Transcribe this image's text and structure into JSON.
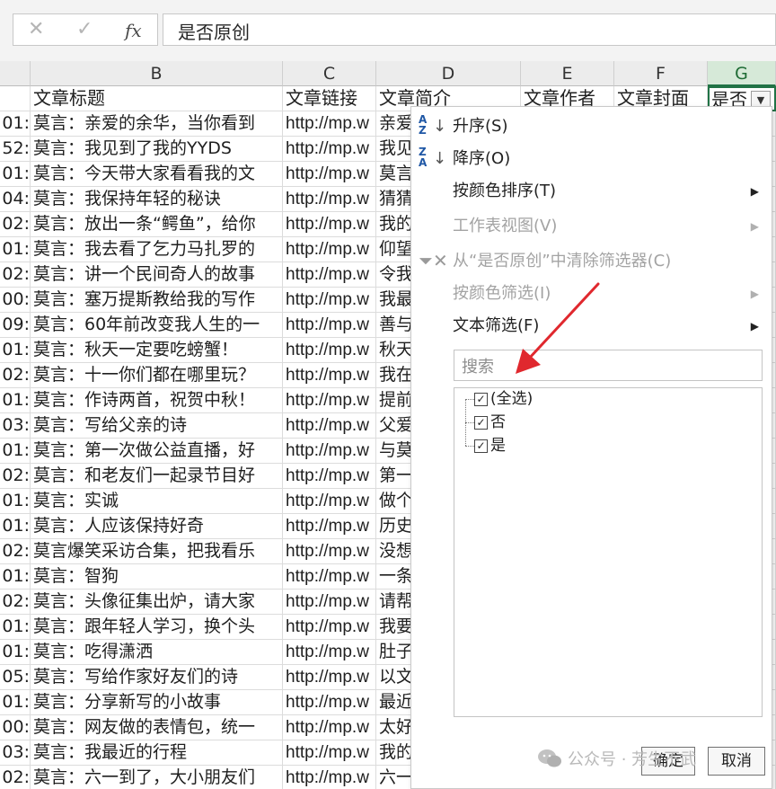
{
  "formula_bar": {
    "cancel_icon": "✕",
    "enter_icon": "✓",
    "fx_label": "fx",
    "value": "是否原创"
  },
  "columns": [
    "B",
    "C",
    "D",
    "E",
    "F",
    "G"
  ],
  "header_row": {
    "a": "",
    "b": "文章标题",
    "c": "文章链接",
    "d": "文章简介",
    "e": "文章作者",
    "f": "文章封面",
    "g": "是否"
  },
  "rows": [
    {
      "a": ":01",
      "b": "莫言：亲爱的余华，当你看到",
      "c": "http://mp.w",
      "d": "亲爱"
    },
    {
      "a": ":52",
      "b": "莫言：我见到了我的YYDS",
      "c": "http://mp.w",
      "d": "我见"
    },
    {
      "a": ":01",
      "b": "莫言：今天带大家看看我的文",
      "c": "http://mp.w",
      "d": "莫言"
    },
    {
      "a": ":04",
      "b": "莫言：我保持年轻的秘诀",
      "c": "http://mp.w",
      "d": "猜猜"
    },
    {
      "a": ":02",
      "b": "莫言：放出一条“鳄鱼”，给你",
      "c": "http://mp.w",
      "d": "我的"
    },
    {
      "a": ":01",
      "b": "莫言：我去看了乞力马扎罗的",
      "c": "http://mp.w",
      "d": "仰望"
    },
    {
      "a": ":02",
      "b": "莫言：讲一个民间奇人的故事",
      "c": "http://mp.w",
      "d": "令我"
    },
    {
      "a": ":00",
      "b": "莫言：塞万提斯教给我的写作",
      "c": "http://mp.w",
      "d": "我最"
    },
    {
      "a": ":09",
      "b": "莫言：60年前改变我人生的一",
      "c": "http://mp.w",
      "d": "善与"
    },
    {
      "a": ":01",
      "b": "莫言：秋天一定要吃螃蟹！",
      "c": "http://mp.w",
      "d": "秋天"
    },
    {
      "a": ":02",
      "b": "莫言：十一你们都在哪里玩？",
      "c": "http://mp.w",
      "d": "我在"
    },
    {
      "a": ":01",
      "b": "莫言：作诗两首，祝贺中秋！",
      "c": "http://mp.w",
      "d": "提前"
    },
    {
      "a": ":03",
      "b": "莫言：写给父亲的诗",
      "c": "http://mp.w",
      "d": "父爱"
    },
    {
      "a": ":01",
      "b": "莫言：第一次做公益直播，好",
      "c": "http://mp.w",
      "d": "与莫"
    },
    {
      "a": ":02",
      "b": "莫言：和老友们一起录节目好",
      "c": "http://mp.w",
      "d": "第一"
    },
    {
      "a": ":01",
      "b": "莫言：实诚",
      "c": "http://mp.w",
      "d": "做个"
    },
    {
      "a": ":01",
      "b": "莫言：人应该保持好奇",
      "c": "http://mp.w",
      "d": "历史"
    },
    {
      "a": ":02",
      "b": "莫言爆笑采访合集，把我看乐",
      "c": "http://mp.w",
      "d": "没想"
    },
    {
      "a": ":01",
      "b": "莫言：智狗",
      "c": "http://mp.w",
      "d": "一条"
    },
    {
      "a": ":02",
      "b": "莫言：头像征集出炉，请大家",
      "c": "http://mp.w",
      "d": "请帮"
    },
    {
      "a": ":01",
      "b": "莫言：跟年轻人学习，换个头",
      "c": "http://mp.w",
      "d": "我要"
    },
    {
      "a": ":01",
      "b": "莫言：吃得潇洒",
      "c": "http://mp.w",
      "d": "肚子"
    },
    {
      "a": ":05",
      "b": "莫言：写给作家好友们的诗",
      "c": "http://mp.w",
      "d": "以文"
    },
    {
      "a": ":01",
      "b": "莫言：分享新写的小故事",
      "c": "http://mp.w",
      "d": "最近"
    },
    {
      "a": ":00",
      "b": "莫言：网友做的表情包，统一",
      "c": "http://mp.w",
      "d": "太好"
    },
    {
      "a": ":03",
      "b": "莫言：我最近的行程",
      "c": "http://mp.w",
      "d": "我的"
    },
    {
      "a": ":02",
      "b": "莫言：六一到了，大小朋友们",
      "c": "http://mp.w",
      "d": "六一"
    }
  ],
  "filter_menu": {
    "items": [
      {
        "label": "升序(S)",
        "icon": "sort-ascending-icon",
        "disabled": false,
        "submenu": false
      },
      {
        "label": "降序(O)",
        "icon": "sort-descending-icon",
        "disabled": false,
        "submenu": false
      },
      {
        "label": "按颜色排序(T)",
        "icon": "",
        "disabled": false,
        "submenu": true
      },
      {
        "label": "工作表视图(V)",
        "icon": "",
        "disabled": true,
        "submenu": true
      },
      {
        "label": "从“是否原创”中清除筛选器(C)",
        "icon": "clear-filter-icon",
        "disabled": true,
        "submenu": false
      },
      {
        "label": "按颜色筛选(I)",
        "icon": "",
        "disabled": true,
        "submenu": true
      },
      {
        "label": "文本筛选(F)",
        "icon": "",
        "disabled": false,
        "submenu": true
      }
    ],
    "search_placeholder": "搜索",
    "values": [
      {
        "label": "(全选)",
        "checked": true
      },
      {
        "label": "否",
        "checked": true
      },
      {
        "label": "是",
        "checked": true
      }
    ],
    "ok_label": "确定",
    "cancel_label": "取消"
  },
  "watermark": {
    "text": "公众号 · 芳生不武",
    "icon": "wechat-icon"
  },
  "colors": {
    "selected_header": "#217346",
    "annotation_arrow": "#e0282e"
  }
}
